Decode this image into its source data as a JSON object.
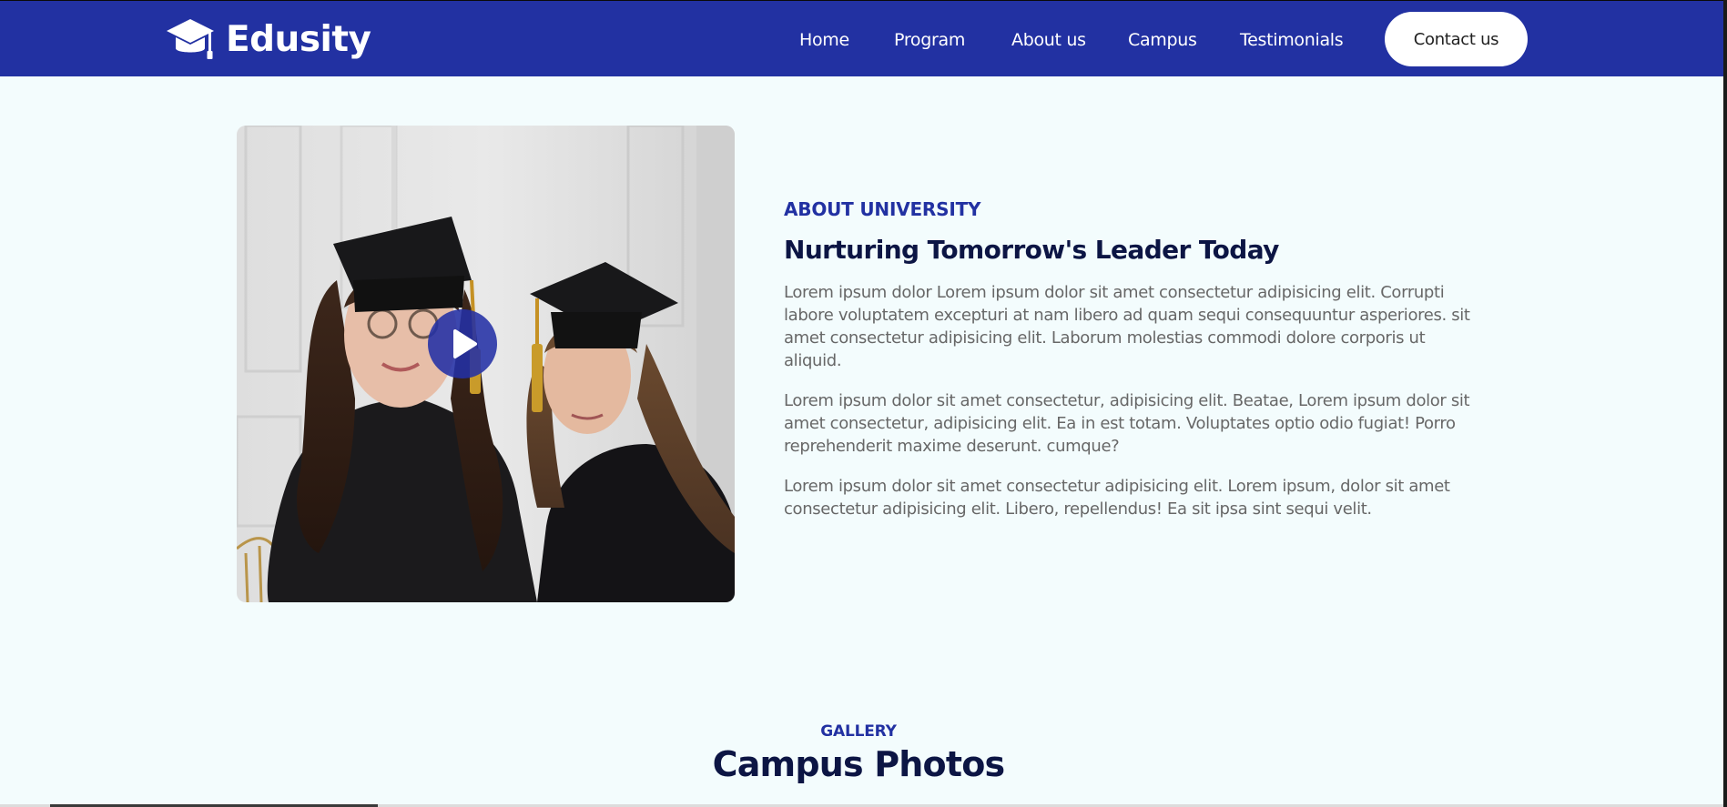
{
  "brand": {
    "name": "Edusity",
    "icon": "graduation-cap-icon"
  },
  "nav": {
    "items": [
      {
        "label": "Home"
      },
      {
        "label": "Program"
      },
      {
        "label": "About us"
      },
      {
        "label": "Campus"
      },
      {
        "label": "Testimonials"
      }
    ],
    "contact_label": "Contact us"
  },
  "about": {
    "subtitle": "ABOUT UNIVERSITY",
    "title": "Nurturing Tomorrow's Leader Today",
    "paragraphs": [
      "Lorem ipsum dolor Lorem ipsum dolor sit amet consectetur adipisicing elit. Corrupti labore voluptatem excepturi at nam libero ad quam sequi consequuntur asperiores. sit amet consectetur adipisicing elit. Laborum molestias commodi dolore corporis ut aliquid.",
      "Lorem ipsum dolor sit amet consectetur, adipisicing elit. Beatae, Lorem ipsum dolor sit amet consectetur, adipisicing elit. Ea in est totam. Voluptates optio odio fugiat! Porro reprehenderit maxime deserunt. cumque?",
      "Lorem ipsum dolor sit amet consectetur adipisicing elit. Lorem ipsum, dolor sit amet consectetur adipisicing elit. Libero, repellendus! Ea sit ipsa sint sequi velit."
    ],
    "play_icon": "play-icon"
  },
  "gallery": {
    "subtitle": "GALLERY",
    "title": "Campus Photos"
  },
  "colors": {
    "primary": "#2231a2",
    "heading": "#0c1544",
    "body_text": "#676767",
    "background": "#f3fcfd"
  }
}
